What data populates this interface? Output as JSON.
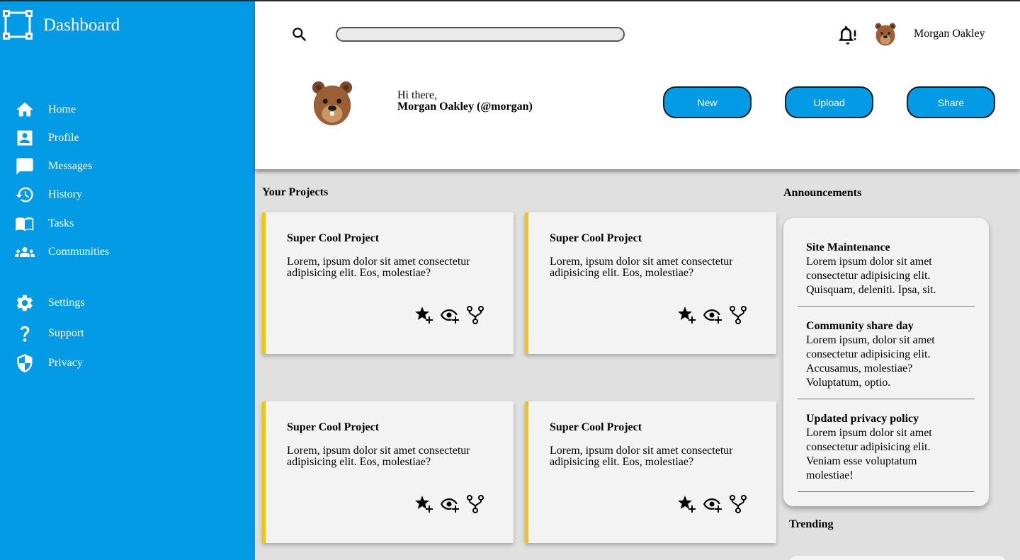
{
  "app": {
    "title": "Dashboard"
  },
  "colors": {
    "sidebar": "#039be5",
    "accent": "#f1c40f",
    "button": "#039be5"
  },
  "sidebar": {
    "main_items": [
      {
        "label": "Home",
        "icon": "home-icon"
      },
      {
        "label": "Profile",
        "icon": "profile-icon"
      },
      {
        "label": "Messages",
        "icon": "messages-icon"
      },
      {
        "label": "History",
        "icon": "history-icon"
      },
      {
        "label": "Tasks",
        "icon": "book-icon"
      },
      {
        "label": "Communities",
        "icon": "people-icon"
      }
    ],
    "secondary_items": [
      {
        "label": "Settings",
        "icon": "gear-icon"
      },
      {
        "label": "Support",
        "icon": "question-icon"
      },
      {
        "label": "Privacy",
        "icon": "shield-icon"
      }
    ]
  },
  "header": {
    "search_placeholder": "",
    "user_name": "Morgan Oakley",
    "greeting": "Hi there,",
    "user_full": "Morgan Oakley (@morgan)",
    "buttons": {
      "new": "New",
      "upload": "Upload",
      "share": "Share"
    }
  },
  "projects": {
    "title": "Your Projects",
    "items": [
      {
        "title": "Super Cool Project",
        "desc": "Lorem, ipsum dolor sit amet consectetur adipisicing elit. Eos, molestiae?"
      },
      {
        "title": "Super Cool Project",
        "desc": "Lorem, ipsum dolor sit amet consectetur adipisicing elit. Eos, molestiae?"
      },
      {
        "title": "Super Cool Project",
        "desc": "Lorem, ipsum dolor sit amet consectetur adipisicing elit. Eos, molestiae?"
      },
      {
        "title": "Super Cool Project",
        "desc": "Lorem, ipsum dolor sit amet consectetur adipisicing elit. Eos, molestiae?"
      }
    ]
  },
  "announcements": {
    "title": "Announcements",
    "items": [
      {
        "title": "Site Maintenance",
        "body": "Lorem ipsum dolor sit amet consectetur adipisicing elit. Quisquam, deleniti. Ipsa, sit."
      },
      {
        "title": "Community share day",
        "body": "Lorem ipsum, dolor sit amet consectetur adipisicing elit. Accusamus, molestiae? Voluptatum, optio."
      },
      {
        "title": "Updated privacy policy",
        "body": "Lorem ipsum dolor sit amet consectetur adipisicing elit. Veniam esse voluptatum molestiae!"
      }
    ]
  },
  "trending": {
    "title": "Trending"
  }
}
